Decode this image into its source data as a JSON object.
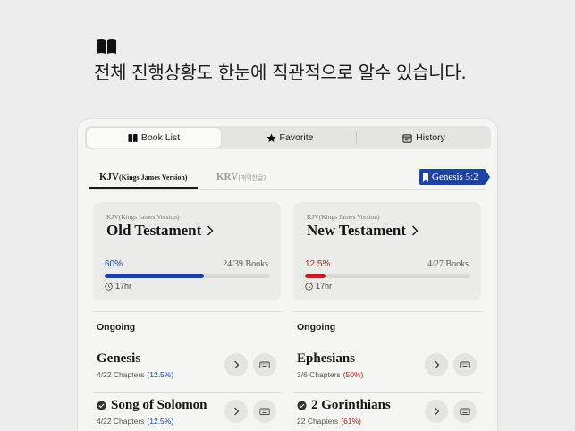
{
  "hero": {
    "caption": "전체 진행상황도 한눈에 직관적으로 알수 있습니다."
  },
  "tabs": [
    {
      "label": "Book List",
      "icon": "book-open-icon"
    },
    {
      "label": "Favorite",
      "icon": "star-icon"
    },
    {
      "label": "History",
      "icon": "calendar-icon"
    }
  ],
  "versions": {
    "active": {
      "code": "KJV",
      "name": "(Kings James Version)"
    },
    "inactive": {
      "code": "KRV",
      "name": "(개역한글)"
    }
  },
  "bookmark": {
    "label": "Genesis 5:2"
  },
  "cards": {
    "old": {
      "version": "KJV(Kings James Version)",
      "title": "Old Testament",
      "percent": "60%",
      "progress": 0.6,
      "books": "24/39 Books",
      "duration": "17hr",
      "color": "#1d43a6"
    },
    "new": {
      "version": "KJV(Kings James Version)",
      "title": "New Testament",
      "percent": "12.5%",
      "progress": 0.125,
      "books": "4/27 Books",
      "duration": "17hr",
      "color": "#b8261e"
    }
  },
  "ongoing": {
    "label": "Ongoing",
    "left": [
      {
        "title": "Genesis",
        "chapters": "4/22 Chapters",
        "pct": "(12.5%)",
        "pct_color": "#1d43a6",
        "done": false
      },
      {
        "title": "Song of Solomon",
        "chapters": "4/22 Chapters",
        "pct": "(12.5%)",
        "pct_color": "#1d43a6",
        "done": true
      }
    ],
    "right": [
      {
        "title": "Ephesians",
        "chapters": "3/6 Chapters",
        "pct": "(50%)",
        "pct_color": "#b8261e",
        "done": false
      },
      {
        "title": "2 Gorinthians",
        "chapters": "22 Chapters",
        "pct": "(61%)",
        "pct_color": "#b8261e",
        "done": true
      }
    ]
  }
}
